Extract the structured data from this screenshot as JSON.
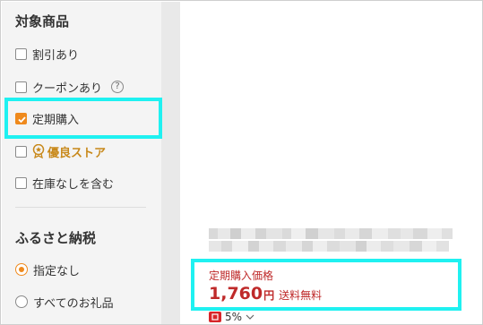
{
  "target_section": {
    "title": "対象商品",
    "options": [
      {
        "label": "割引あり",
        "checked": false
      },
      {
        "label": "クーポンあり",
        "checked": false,
        "help_icon": "?"
      },
      {
        "label": "定期購入",
        "checked": true
      },
      {
        "label": "優良ストア",
        "checked": false,
        "badge": true
      },
      {
        "label": "在庫なしを含む",
        "checked": false
      }
    ]
  },
  "furusato_section": {
    "title": "ふるさと納税",
    "options": [
      {
        "label": "指定なし",
        "selected": true
      },
      {
        "label": "すべてのお礼品",
        "selected": false
      }
    ]
  },
  "product": {
    "price_label": "定期購入価格",
    "price": "1,760",
    "currency": "円",
    "shipping": "送料無料",
    "points_rate": "5%"
  },
  "colors": {
    "accent": "#ef8a1d",
    "price_red": "#bf2a2a",
    "highlight": "#1ff1f1",
    "badge_gold": "#c8891b"
  }
}
